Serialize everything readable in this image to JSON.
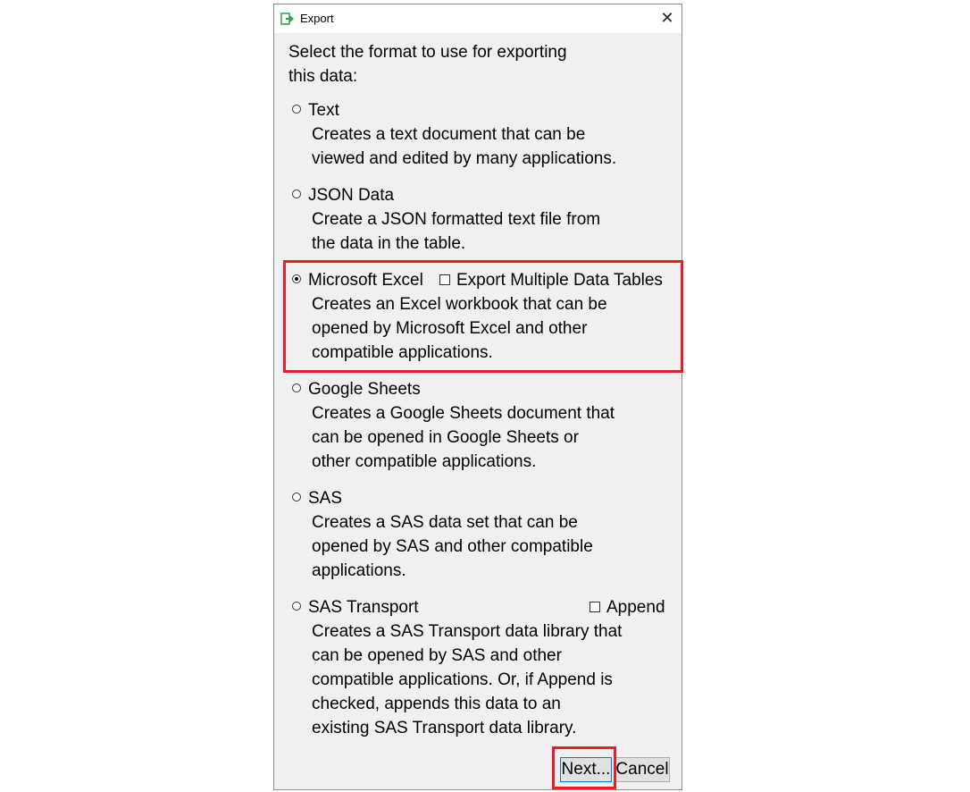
{
  "window": {
    "title": "Export",
    "icon": "export-arrow-icon",
    "close_icon": "close-icon",
    "close_glyph": "✕"
  },
  "prompt": [
    "Select the format to use for exporting",
    "this data:"
  ],
  "options": [
    {
      "label": "Text",
      "selected": false,
      "description": [
        "Creates a text document that can be",
        "viewed and edited by many applications."
      ]
    },
    {
      "label": "JSON Data",
      "selected": false,
      "description": [
        "Create a JSON formatted text file from",
        "the data in the table."
      ]
    },
    {
      "label": "Microsoft Excel",
      "selected": true,
      "checkbox": {
        "label": "Export Multiple Data Tables",
        "checked": false
      },
      "description": [
        "Creates an Excel workbook that can be",
        "opened by Microsoft Excel and other",
        "compatible applications."
      ]
    },
    {
      "label": "Google Sheets",
      "selected": false,
      "description": [
        "Creates a Google Sheets document that",
        "can be opened in Google Sheets or",
        "other compatible applications."
      ]
    },
    {
      "label": "SAS",
      "selected": false,
      "description": [
        "Creates a SAS data set that can be",
        "opened by SAS and other compatible",
        "applications."
      ]
    },
    {
      "label": "SAS Transport",
      "selected": false,
      "checkbox": {
        "label": "Append",
        "checked": false
      },
      "description": [
        "Creates a SAS Transport data library that",
        "can be opened by SAS and other",
        "compatible applications. Or, if Append is",
        "checked, appends this data to an",
        "existing SAS Transport data library."
      ]
    }
  ],
  "buttons": {
    "next": "Next...",
    "cancel": "Cancel"
  },
  "colors": {
    "highlight": "#e5202b",
    "dialog_bg": "#f0f0f0",
    "icon_green": "#2e9e4f"
  }
}
